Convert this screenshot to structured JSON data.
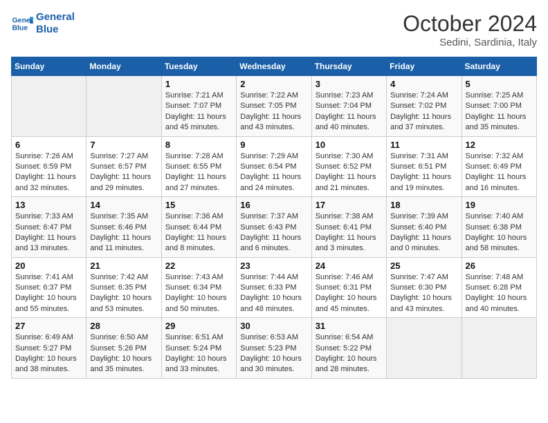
{
  "logo": {
    "name1": "General",
    "name2": "Blue"
  },
  "title": "October 2024",
  "subtitle": "Sedini, Sardinia, Italy",
  "days_header": [
    "Sunday",
    "Monday",
    "Tuesday",
    "Wednesday",
    "Thursday",
    "Friday",
    "Saturday"
  ],
  "weeks": [
    [
      {
        "num": "",
        "sunrise": "",
        "sunset": "",
        "daylight": ""
      },
      {
        "num": "",
        "sunrise": "",
        "sunset": "",
        "daylight": ""
      },
      {
        "num": "1",
        "sunrise": "Sunrise: 7:21 AM",
        "sunset": "Sunset: 7:07 PM",
        "daylight": "Daylight: 11 hours and 45 minutes."
      },
      {
        "num": "2",
        "sunrise": "Sunrise: 7:22 AM",
        "sunset": "Sunset: 7:05 PM",
        "daylight": "Daylight: 11 hours and 43 minutes."
      },
      {
        "num": "3",
        "sunrise": "Sunrise: 7:23 AM",
        "sunset": "Sunset: 7:04 PM",
        "daylight": "Daylight: 11 hours and 40 minutes."
      },
      {
        "num": "4",
        "sunrise": "Sunrise: 7:24 AM",
        "sunset": "Sunset: 7:02 PM",
        "daylight": "Daylight: 11 hours and 37 minutes."
      },
      {
        "num": "5",
        "sunrise": "Sunrise: 7:25 AM",
        "sunset": "Sunset: 7:00 PM",
        "daylight": "Daylight: 11 hours and 35 minutes."
      }
    ],
    [
      {
        "num": "6",
        "sunrise": "Sunrise: 7:26 AM",
        "sunset": "Sunset: 6:59 PM",
        "daylight": "Daylight: 11 hours and 32 minutes."
      },
      {
        "num": "7",
        "sunrise": "Sunrise: 7:27 AM",
        "sunset": "Sunset: 6:57 PM",
        "daylight": "Daylight: 11 hours and 29 minutes."
      },
      {
        "num": "8",
        "sunrise": "Sunrise: 7:28 AM",
        "sunset": "Sunset: 6:55 PM",
        "daylight": "Daylight: 11 hours and 27 minutes."
      },
      {
        "num": "9",
        "sunrise": "Sunrise: 7:29 AM",
        "sunset": "Sunset: 6:54 PM",
        "daylight": "Daylight: 11 hours and 24 minutes."
      },
      {
        "num": "10",
        "sunrise": "Sunrise: 7:30 AM",
        "sunset": "Sunset: 6:52 PM",
        "daylight": "Daylight: 11 hours and 21 minutes."
      },
      {
        "num": "11",
        "sunrise": "Sunrise: 7:31 AM",
        "sunset": "Sunset: 6:51 PM",
        "daylight": "Daylight: 11 hours and 19 minutes."
      },
      {
        "num": "12",
        "sunrise": "Sunrise: 7:32 AM",
        "sunset": "Sunset: 6:49 PM",
        "daylight": "Daylight: 11 hours and 16 minutes."
      }
    ],
    [
      {
        "num": "13",
        "sunrise": "Sunrise: 7:33 AM",
        "sunset": "Sunset: 6:47 PM",
        "daylight": "Daylight: 11 hours and 13 minutes."
      },
      {
        "num": "14",
        "sunrise": "Sunrise: 7:35 AM",
        "sunset": "Sunset: 6:46 PM",
        "daylight": "Daylight: 11 hours and 11 minutes."
      },
      {
        "num": "15",
        "sunrise": "Sunrise: 7:36 AM",
        "sunset": "Sunset: 6:44 PM",
        "daylight": "Daylight: 11 hours and 8 minutes."
      },
      {
        "num": "16",
        "sunrise": "Sunrise: 7:37 AM",
        "sunset": "Sunset: 6:43 PM",
        "daylight": "Daylight: 11 hours and 6 minutes."
      },
      {
        "num": "17",
        "sunrise": "Sunrise: 7:38 AM",
        "sunset": "Sunset: 6:41 PM",
        "daylight": "Daylight: 11 hours and 3 minutes."
      },
      {
        "num": "18",
        "sunrise": "Sunrise: 7:39 AM",
        "sunset": "Sunset: 6:40 PM",
        "daylight": "Daylight: 11 hours and 0 minutes."
      },
      {
        "num": "19",
        "sunrise": "Sunrise: 7:40 AM",
        "sunset": "Sunset: 6:38 PM",
        "daylight": "Daylight: 10 hours and 58 minutes."
      }
    ],
    [
      {
        "num": "20",
        "sunrise": "Sunrise: 7:41 AM",
        "sunset": "Sunset: 6:37 PM",
        "daylight": "Daylight: 10 hours and 55 minutes."
      },
      {
        "num": "21",
        "sunrise": "Sunrise: 7:42 AM",
        "sunset": "Sunset: 6:35 PM",
        "daylight": "Daylight: 10 hours and 53 minutes."
      },
      {
        "num": "22",
        "sunrise": "Sunrise: 7:43 AM",
        "sunset": "Sunset: 6:34 PM",
        "daylight": "Daylight: 10 hours and 50 minutes."
      },
      {
        "num": "23",
        "sunrise": "Sunrise: 7:44 AM",
        "sunset": "Sunset: 6:33 PM",
        "daylight": "Daylight: 10 hours and 48 minutes."
      },
      {
        "num": "24",
        "sunrise": "Sunrise: 7:46 AM",
        "sunset": "Sunset: 6:31 PM",
        "daylight": "Daylight: 10 hours and 45 minutes."
      },
      {
        "num": "25",
        "sunrise": "Sunrise: 7:47 AM",
        "sunset": "Sunset: 6:30 PM",
        "daylight": "Daylight: 10 hours and 43 minutes."
      },
      {
        "num": "26",
        "sunrise": "Sunrise: 7:48 AM",
        "sunset": "Sunset: 6:28 PM",
        "daylight": "Daylight: 10 hours and 40 minutes."
      }
    ],
    [
      {
        "num": "27",
        "sunrise": "Sunrise: 6:49 AM",
        "sunset": "Sunset: 5:27 PM",
        "daylight": "Daylight: 10 hours and 38 minutes."
      },
      {
        "num": "28",
        "sunrise": "Sunrise: 6:50 AM",
        "sunset": "Sunset: 5:26 PM",
        "daylight": "Daylight: 10 hours and 35 minutes."
      },
      {
        "num": "29",
        "sunrise": "Sunrise: 6:51 AM",
        "sunset": "Sunset: 5:24 PM",
        "daylight": "Daylight: 10 hours and 33 minutes."
      },
      {
        "num": "30",
        "sunrise": "Sunrise: 6:53 AM",
        "sunset": "Sunset: 5:23 PM",
        "daylight": "Daylight: 10 hours and 30 minutes."
      },
      {
        "num": "31",
        "sunrise": "Sunrise: 6:54 AM",
        "sunset": "Sunset: 5:22 PM",
        "daylight": "Daylight: 10 hours and 28 minutes."
      },
      {
        "num": "",
        "sunrise": "",
        "sunset": "",
        "daylight": ""
      },
      {
        "num": "",
        "sunrise": "",
        "sunset": "",
        "daylight": ""
      }
    ]
  ]
}
